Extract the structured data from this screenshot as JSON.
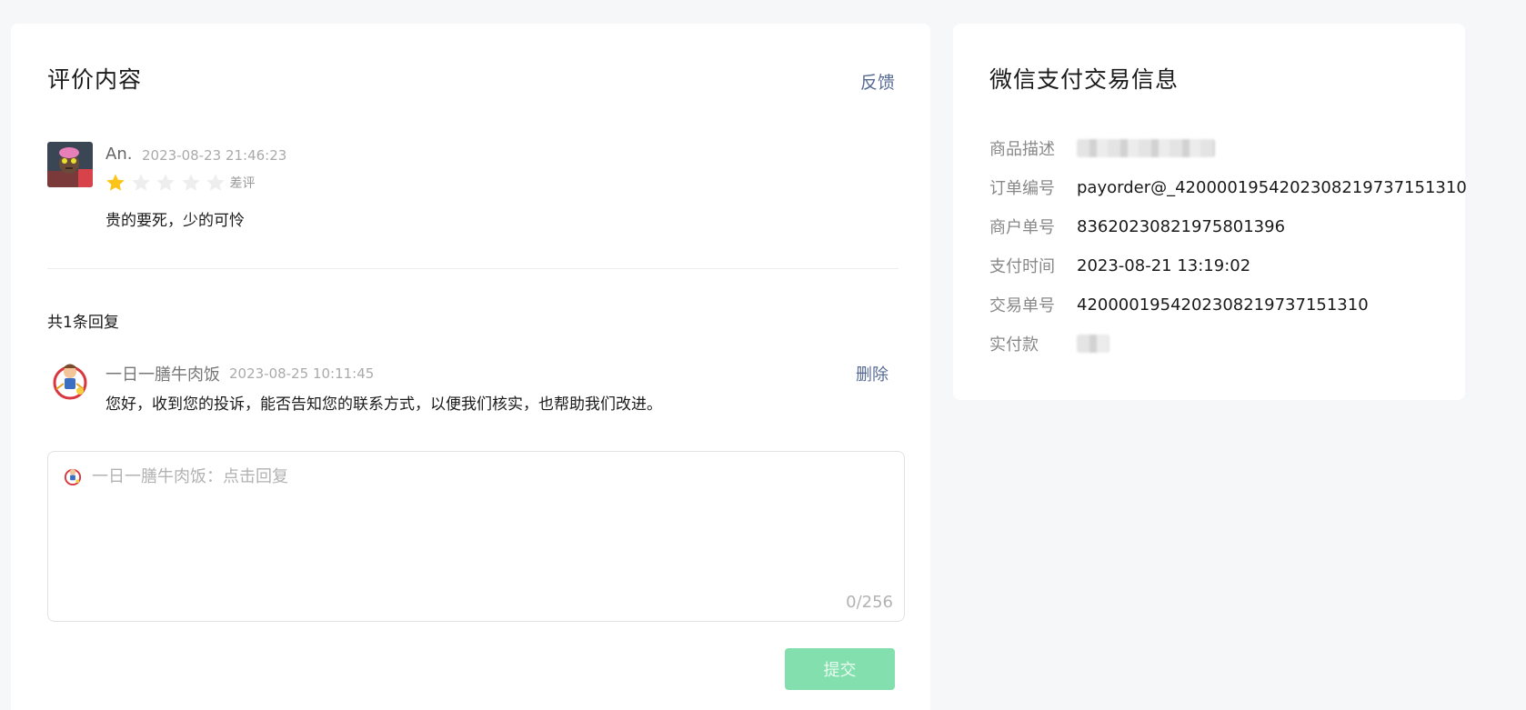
{
  "review": {
    "title": "评价内容",
    "feedback_label": "反馈",
    "reviewer_name": "An.",
    "time": "2023-08-23 21:46:23",
    "rating": 1,
    "rating_max": 5,
    "rating_label": "差评",
    "text": "贵的要死，少的可怜",
    "colors": {
      "star_on": "#fcc419",
      "star_off": "#eeeeee"
    }
  },
  "replies": {
    "count_label": "共1条回复",
    "items": [
      {
        "name": "一日一膳牛肉饭",
        "time": "2023-08-25 10:11:45",
        "delete_label": "删除",
        "text": "您好，收到您的投诉，能否告知您的联系方式，以便我们核实，也帮助我们改进。"
      }
    ]
  },
  "reply_box": {
    "placeholder": "一日一膳牛肉饭：点击回复",
    "char_count": "0/256",
    "submit_label": "提交"
  },
  "payment": {
    "title": "微信支付交易信息",
    "rows": [
      {
        "label": "商品描述",
        "value": ""
      },
      {
        "label": "订单编号",
        "value": "payorder@_4200001954202308219737151310"
      },
      {
        "label": "商户单号",
        "value": "83620230821975801396"
      },
      {
        "label": "支付时间",
        "value": "2023-08-21 13:19:02"
      },
      {
        "label": "交易单号",
        "value": "4200001954202308219737151310"
      },
      {
        "label": "实付款",
        "value": ""
      }
    ]
  },
  "colors": {
    "link": "#576b95",
    "submit_bg": "#83e0ae",
    "page_bg": "#f6f7f9"
  }
}
